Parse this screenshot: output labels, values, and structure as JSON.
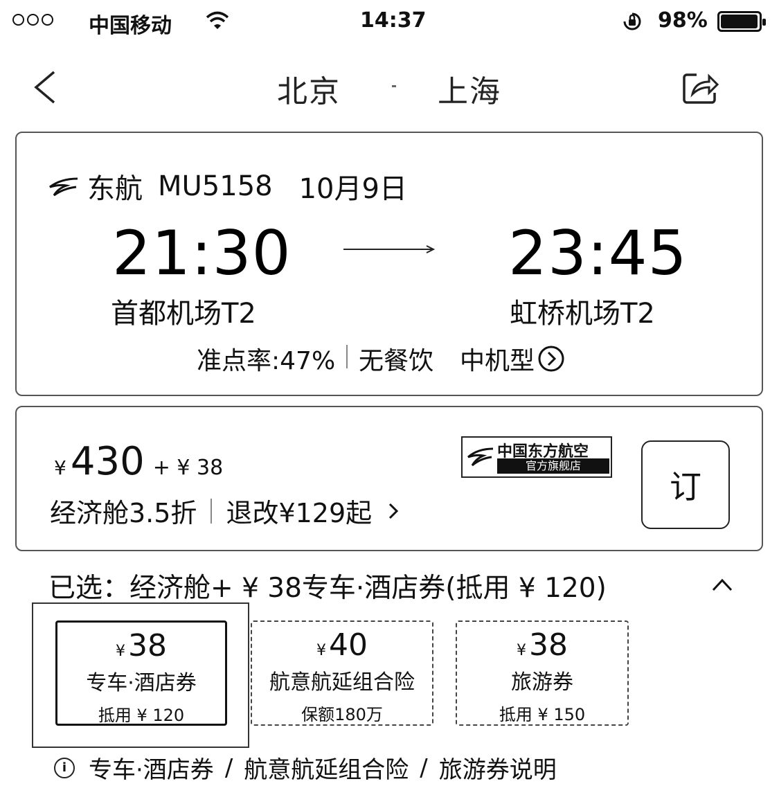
{
  "status_bar": {
    "carrier": "中国移动",
    "time": "14:37",
    "battery_text": "98%",
    "battery_level": 0.98
  },
  "nav": {
    "origin": "北京",
    "destination": "上海"
  },
  "flight": {
    "airline": "东航",
    "flight_no": "MU5158",
    "date": "10月9日",
    "depart_time": "21:30",
    "arrive_time": "23:45",
    "depart_airport": "首都机场T2",
    "arrive_airport": "虹桥机场T2",
    "on_time": "准点率:47%",
    "meal": "无餐饮",
    "aircraft": "中机型"
  },
  "price_card": {
    "currency": "¥",
    "price": "430",
    "addon": "+ ¥ 38",
    "logo_line1": "中国东方航空",
    "logo_line2": "官方旗舰店",
    "cabin": "经济舱3.5折",
    "refund": "退改¥129起",
    "book_label": "订"
  },
  "selected": {
    "text": "已选：经济舱+ ¥ 38专车·酒店券(抵用 ¥ 120)"
  },
  "options": [
    {
      "currency": "¥",
      "price": "38",
      "name": "专车·酒店券",
      "note": "抵用 ¥ 120"
    },
    {
      "currency": "¥",
      "price": "40",
      "name": "航意航延组合险",
      "note": "保额180万"
    },
    {
      "currency": "¥",
      "price": "38",
      "name": "旅游券",
      "note": "抵用 ¥ 150"
    }
  ],
  "footer": {
    "link1": "专车·酒店券",
    "sep": "/",
    "link2": "航意航延组合险",
    "link3": "旅游券说明"
  }
}
